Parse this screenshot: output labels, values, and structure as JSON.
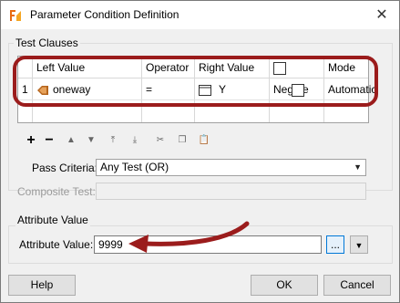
{
  "window": {
    "title": "Parameter Condition Definition",
    "close_glyph": "✕"
  },
  "test_clauses": {
    "group_label": "Test Clauses",
    "columns": {
      "left_value": "Left Value",
      "operator": "Operator",
      "right_value": "Right Value",
      "negate": "Negate",
      "mode": "Mode"
    },
    "rows": [
      {
        "num": "1",
        "left_value": "oneway",
        "operator": "=",
        "right_value": "Y",
        "negate": false,
        "mode": "Automatic"
      }
    ]
  },
  "toolbar_icons": [
    "add-icon",
    "remove-icon",
    "move-up-icon",
    "move-down-icon",
    "move-top-icon",
    "move-bottom-icon",
    "cut-icon",
    "copy-icon",
    "paste-icon"
  ],
  "pass_criteria": {
    "label": "Pass Criteria:",
    "value": "Any Test (OR)"
  },
  "composite_test": {
    "label": "Composite Test:",
    "value": ""
  },
  "attribute_value": {
    "group_label": "Attribute Value",
    "label": "Attribute Value:",
    "value": "9999",
    "ellipsis_label": "..."
  },
  "buttons": {
    "help": "Help",
    "ok": "OK",
    "cancel": "Cancel"
  },
  "colors": {
    "annotation_red": "#9b1c1c",
    "attribute_icon": "#b5651d"
  }
}
